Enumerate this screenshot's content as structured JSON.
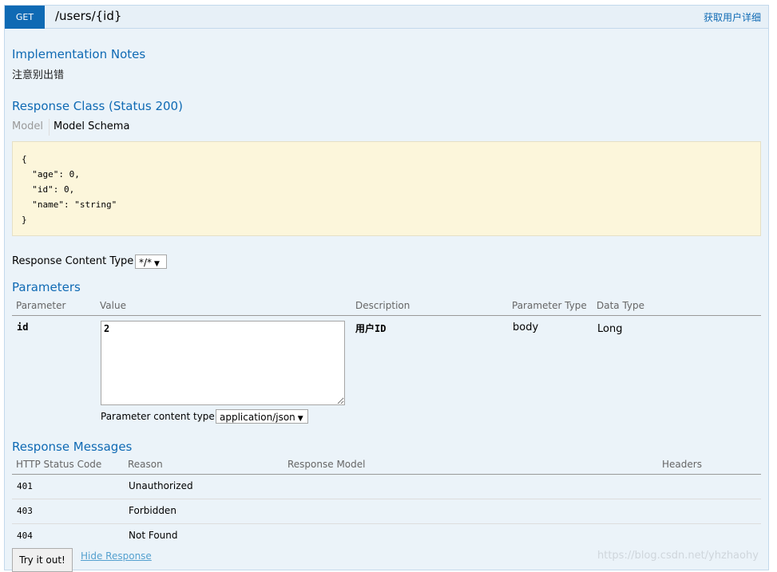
{
  "operation": {
    "method": "GET",
    "path": "/users/{id}",
    "summary": "获取用户详细"
  },
  "implementation_notes": {
    "title": "Implementation Notes",
    "text": "注意别出错"
  },
  "response_class": {
    "title": "Response Class (Status 200)",
    "tabs": [
      "Model",
      "Model Schema"
    ],
    "active_tab": "Model Schema",
    "schema": "{\n  \"age\": 0,\n  \"id\": 0,\n  \"name\": \"string\"\n}"
  },
  "response_content_type": {
    "label": "Response Content Type",
    "selected": "*/*"
  },
  "parameters": {
    "title": "Parameters",
    "headers": [
      "Parameter",
      "Value",
      "Description",
      "Parameter Type",
      "Data Type"
    ],
    "rows": [
      {
        "name": "id",
        "value": "2",
        "description": "用户ID",
        "param_type": "body",
        "data_type": "Long",
        "content_type_label": "Parameter content type:",
        "content_type": "application/json"
      }
    ]
  },
  "response_messages": {
    "title": "Response Messages",
    "headers": [
      "HTTP Status Code",
      "Reason",
      "Response Model",
      "Headers"
    ],
    "rows": [
      {
        "code": "401",
        "reason": "Unauthorized"
      },
      {
        "code": "403",
        "reason": "Forbidden"
      },
      {
        "code": "404",
        "reason": "Not Found"
      }
    ]
  },
  "actions": {
    "try_label": "Try it out!",
    "hide_label": "Hide Response"
  },
  "watermark": "https://blog.csdn.net/yhzhaohy",
  "colors": {
    "method_bg": "#0f6ab4",
    "section_title": "#0f6ab4",
    "panel_bg": "#ebf3f9",
    "schema_bg": "#fcf6db"
  }
}
